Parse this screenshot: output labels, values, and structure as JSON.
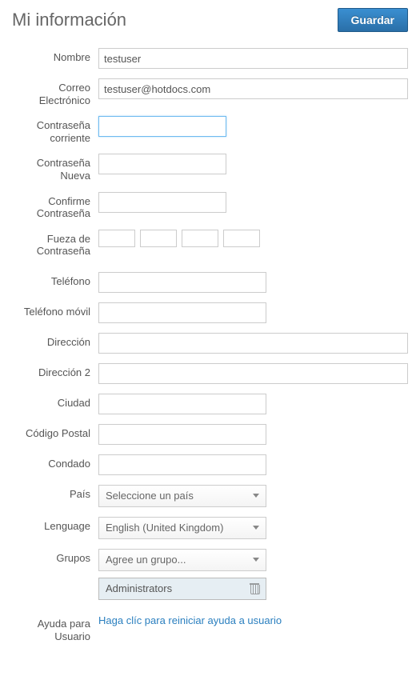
{
  "header": {
    "title": "Mi información",
    "save_label": "Guardar"
  },
  "fields": {
    "name": {
      "label": "Nombre",
      "value": "testuser"
    },
    "email": {
      "label": "Correo Electrónico",
      "value": "testuser@hotdocs.com"
    },
    "current_password": {
      "label": "Contraseña corriente",
      "value": ""
    },
    "new_password": {
      "label": "Contraseña Nueva",
      "value": ""
    },
    "confirm_password": {
      "label": "Confirme Contraseña",
      "value": ""
    },
    "strength": {
      "label": "Fueza de Contraseña"
    },
    "phone": {
      "label": "Teléfono",
      "value": ""
    },
    "mobile": {
      "label": "Teléfono móvil",
      "value": ""
    },
    "address": {
      "label": "Dirección",
      "value": ""
    },
    "address2": {
      "label": "Dirección 2",
      "value": ""
    },
    "city": {
      "label": "Ciudad",
      "value": ""
    },
    "postal": {
      "label": "Código Postal",
      "value": ""
    },
    "county": {
      "label": "Condado",
      "value": ""
    },
    "country": {
      "label": "País",
      "selected": "Seleccione un país"
    },
    "language": {
      "label": "Lenguage",
      "selected": "English (United Kingdom)"
    },
    "groups": {
      "label": "Grupos",
      "selected": "Agree un grupo...",
      "tag": "Administrators"
    },
    "help": {
      "label": "Ayuda para Usuario",
      "link": "Haga clíc para reiniciar ayuda a usuario"
    }
  }
}
